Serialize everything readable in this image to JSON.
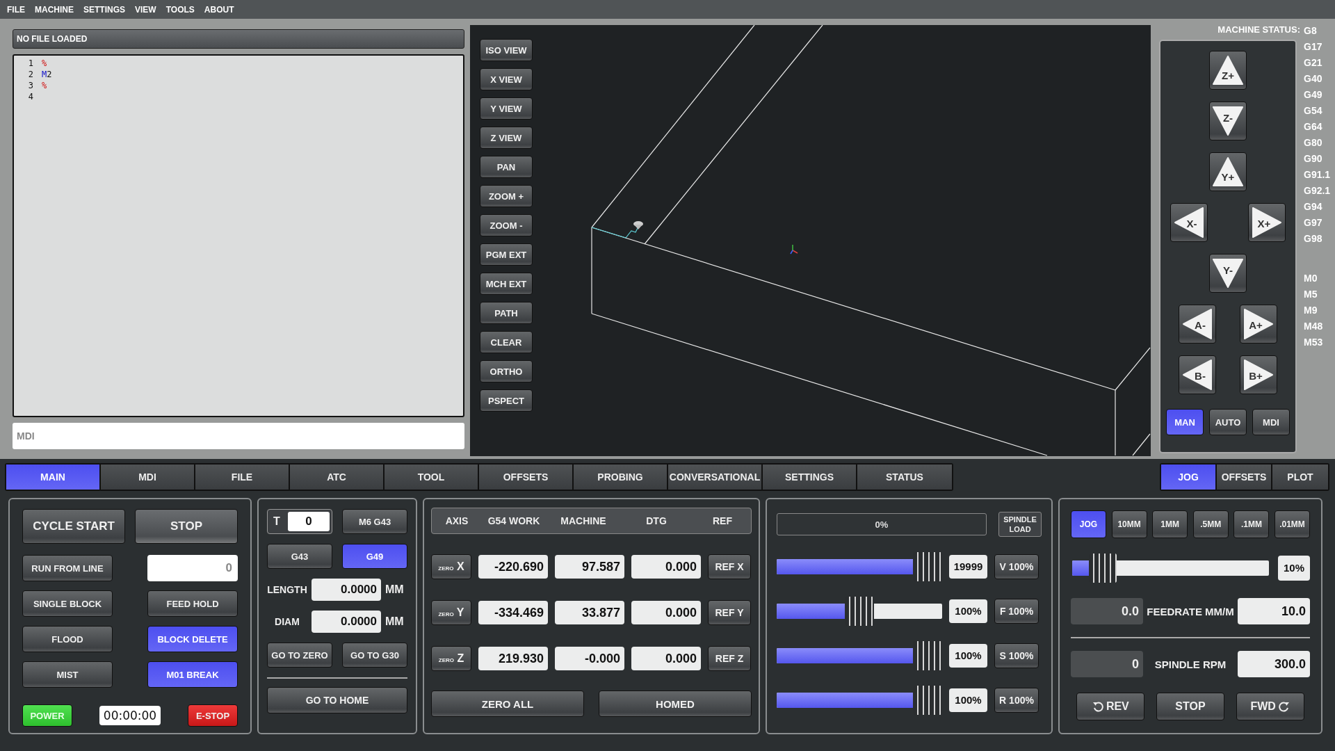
{
  "menu": [
    "FILE",
    "MACHINE",
    "SETTINGS",
    "VIEW",
    "TOOLS",
    "ABOUT"
  ],
  "file_panel": {
    "title": "NO FILE LOADED",
    "lines": [
      {
        "number": "1",
        "tokens": [
          {
            "text": "%",
            "kind": "comment"
          }
        ]
      },
      {
        "number": "2",
        "tokens": [
          {
            "text": "M",
            "kind": "keyword"
          },
          {
            "text": "2",
            "kind": "plain"
          }
        ]
      },
      {
        "number": "3",
        "tokens": [
          {
            "text": "%",
            "kind": "comment"
          }
        ]
      },
      {
        "number": "4"
      }
    ]
  },
  "mdi": {
    "placeholder": "MDI"
  },
  "view_button_groups": [
    [
      "ISO VIEW",
      "X VIEW",
      "Y VIEW",
      "Z VIEW"
    ],
    [
      "PAN",
      "ZOOM +",
      "ZOOM -"
    ],
    [
      "PGM EXT",
      "MCH EXT"
    ],
    [
      "PATH",
      "CLEAR"
    ],
    [
      "ORTHO",
      "PSPECT"
    ]
  ],
  "machine_status": {
    "label": "MACHINE STATUS:",
    "g_codes": [
      "G8",
      "G17",
      "G21",
      "G40",
      "G49",
      "G54",
      "G64",
      "G80",
      "G90",
      "G91.1",
      "G92.1",
      "G94",
      "G97",
      "G98"
    ],
    "m_codes": [
      "M0",
      "M5",
      "M9",
      "M48",
      "M53"
    ]
  },
  "jog_rows": [
    [
      {
        "label": "Z+",
        "kind": "up"
      }
    ],
    [
      {
        "label": "Z-",
        "kind": "down"
      }
    ],
    [
      {
        "label": "Y+",
        "kind": "up"
      }
    ],
    [
      {
        "label": "X-",
        "kind": "left"
      },
      {
        "label": "X+",
        "kind": "right"
      }
    ],
    [
      {
        "label": "Y-",
        "kind": "down"
      }
    ],
    [
      {
        "label": "A-",
        "kind": "left"
      },
      {
        "label": "A+",
        "kind": "right"
      }
    ],
    [
      {
        "label": "B-",
        "kind": "left"
      },
      {
        "label": "B+",
        "kind": "right"
      }
    ]
  ],
  "mode_buttons": [
    {
      "label": "MAN",
      "selected": true
    },
    {
      "label": "AUTO",
      "selected": false
    },
    {
      "label": "MDI",
      "selected": false
    }
  ],
  "main_tabs": [
    {
      "label": "MAIN",
      "selected": true
    },
    {
      "label": "MDI",
      "selected": false
    },
    {
      "label": "FILE",
      "selected": false
    },
    {
      "label": "ATC",
      "selected": false
    },
    {
      "label": "TOOL",
      "selected": false
    },
    {
      "label": "OFFSETS",
      "selected": false
    },
    {
      "label": "PROBING",
      "selected": false
    },
    {
      "label": "CONVERSATIONAL",
      "selected": false
    },
    {
      "label": "SETTINGS",
      "selected": false
    },
    {
      "label": "STATUS",
      "selected": false
    }
  ],
  "side_tabs": [
    {
      "label": "JOG",
      "selected": true
    },
    {
      "label": "OFFSETS",
      "selected": false
    },
    {
      "label": "PLOT",
      "selected": false
    }
  ],
  "program": {
    "cycle_start": "CYCLE START",
    "stop": "STOP",
    "run_from_line": "RUN FROM LINE",
    "start_line": "0",
    "toggles": [
      {
        "label": "SINGLE BLOCK",
        "on": false
      },
      {
        "label": "FEED HOLD",
        "on": false
      },
      {
        "label": "FLOOD",
        "on": false
      },
      {
        "label": "BLOCK DELETE",
        "on": true
      },
      {
        "label": "MIST",
        "on": false
      },
      {
        "label": "M01 BREAK",
        "on": true
      }
    ],
    "power": {
      "label": "POWER",
      "on": true
    },
    "timer": "00:00:00",
    "estop": "E-STOP"
  },
  "tool": {
    "label": "T",
    "number": "0",
    "change_button": "M6 G43",
    "offsets": [
      {
        "label": "G43",
        "selected": false
      },
      {
        "label": "G49",
        "selected": true
      }
    ],
    "measures": [
      {
        "label": "LENGTH",
        "value": "0.0000",
        "unit": "MM"
      },
      {
        "label": "DIAM",
        "value": "0.0000",
        "unit": "MM"
      }
    ],
    "go_buttons": [
      "GO TO ZERO",
      "GO TO G30"
    ],
    "home_button": "GO TO HOME"
  },
  "dro": {
    "columns": [
      "AXIS",
      "G54 WORK",
      "MACHINE",
      "DTG",
      "REF"
    ],
    "axes": [
      {
        "zero_label": "ZERO",
        "axis": "X",
        "work": "-220.690",
        "machine": "97.587",
        "dtg": "0.000",
        "ref": "REF X"
      },
      {
        "zero_label": "ZERO",
        "axis": "Y",
        "work": "-334.469",
        "machine": "33.877",
        "dtg": "0.000",
        "ref": "REF Y"
      },
      {
        "zero_label": "ZERO",
        "axis": "Z",
        "work": "219.930",
        "machine": "-0.000",
        "dtg": "0.000",
        "ref": "REF Z"
      }
    ],
    "zero_all": "ZERO ALL",
    "homed": "HOMED"
  },
  "overrides": {
    "load": {
      "reading": "0%",
      "level": 0,
      "label": "SPINDLE LOAD"
    },
    "sliders": [
      {
        "level": 1,
        "reading": "19999",
        "button": "V 100%"
      },
      {
        "level": 0.5,
        "reading": "100%",
        "button": "F 100%"
      },
      {
        "level": 1,
        "reading": "100%",
        "button": "S 100%"
      },
      {
        "level": 1,
        "reading": "100%",
        "button": "R 100%"
      }
    ]
  },
  "jog": {
    "increments": [
      {
        "label": "JOG",
        "selected": true
      },
      {
        "label": "10MM",
        "selected": false
      },
      {
        "label": "1MM",
        "selected": false
      },
      {
        "label": ".5MM",
        "selected": false
      },
      {
        "label": ".1MM",
        "selected": false
      },
      {
        "label": ".01MM",
        "selected": false
      }
    ],
    "slider": {
      "level": 0.1,
      "reading": "10%"
    },
    "feed": {
      "current": "0.0",
      "label": "FEEDRATE MM/M",
      "setpoint": "10.0"
    },
    "spindle": {
      "current": "0",
      "label": "SPINDLE RPM",
      "setpoint": "300.0"
    },
    "spindle_buttons": [
      {
        "label": "REV",
        "kind": "rev"
      },
      {
        "label": "STOP",
        "kind": "stop"
      },
      {
        "label": "FWD",
        "kind": "fwd"
      }
    ]
  }
}
